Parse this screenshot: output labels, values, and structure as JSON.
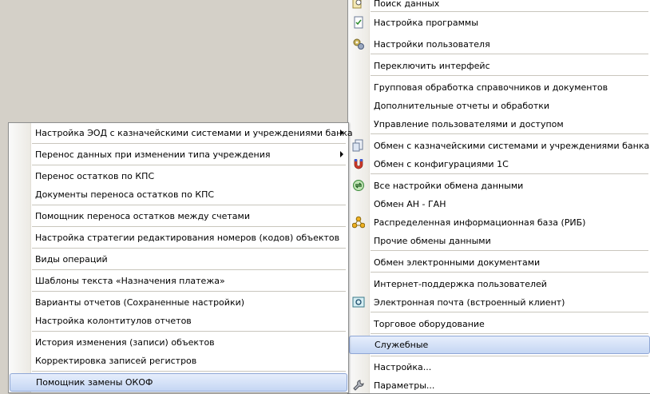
{
  "main_menu": {
    "items": [
      {
        "label": "Поиск данных",
        "icon": "magnifier-icon"
      },
      {
        "label": "Настройка программы",
        "icon": "settings-document-icon"
      },
      {
        "label": "Настройки пользователя",
        "icon": "user-settings-gears-icon"
      },
      {
        "label": "Переключить интерфейс"
      },
      {
        "label": "Групповая обработка справочников и документов"
      },
      {
        "label": "Дополнительные отчеты и обработки"
      },
      {
        "label": "Управление пользователями и доступом"
      },
      {
        "label": "Обмен с казначейскими системами и учреждениями банка",
        "icon": "treasury-exchange-icon"
      },
      {
        "label": "Обмен с конфигурациями 1С",
        "icon": "magnet-icon"
      },
      {
        "label": "Все настройки обмена данными",
        "icon": "exchange-settings-icon"
      },
      {
        "label": "Обмен АН - ГАН"
      },
      {
        "label": "Распределенная информационная база (РИБ)",
        "icon": "distributed-nodes-icon"
      },
      {
        "label": "Прочие обмены данными"
      },
      {
        "label": "Обмен электронными документами"
      },
      {
        "label": "Интернет-поддержка пользователей"
      },
      {
        "label": "Электронная почта (встроенный клиент)",
        "icon": "email-icon"
      },
      {
        "label": "Торговое оборудование"
      },
      {
        "label": "Служебные"
      },
      {
        "label": "Настройка..."
      },
      {
        "label": "Параметры...",
        "icon": "wrench-icon"
      }
    ]
  },
  "sub_menu": {
    "items": [
      {
        "label": "Настройка ЭОД с казначейскими системами и учреждениями банка"
      },
      {
        "label": "Перенос данных при изменении типа учреждения"
      },
      {
        "label": "Перенос остатков по КПС"
      },
      {
        "label": "Документы переноса остатков по КПС"
      },
      {
        "label": "Помощник переноса остатков между счетами"
      },
      {
        "label": "Настройка стратегии редактирования номеров (кодов) объектов"
      },
      {
        "label": "Виды операций"
      },
      {
        "label": "Шаблоны текста «Назначения платежа»"
      },
      {
        "label": "Варианты отчетов (Сохраненные настройки)"
      },
      {
        "label": "Настройка колонтитулов отчетов"
      },
      {
        "label": "История изменения (записи) объектов"
      },
      {
        "label": "Корректировка записей регистров"
      },
      {
        "label": "Помощник замены ОКОФ"
      }
    ]
  }
}
